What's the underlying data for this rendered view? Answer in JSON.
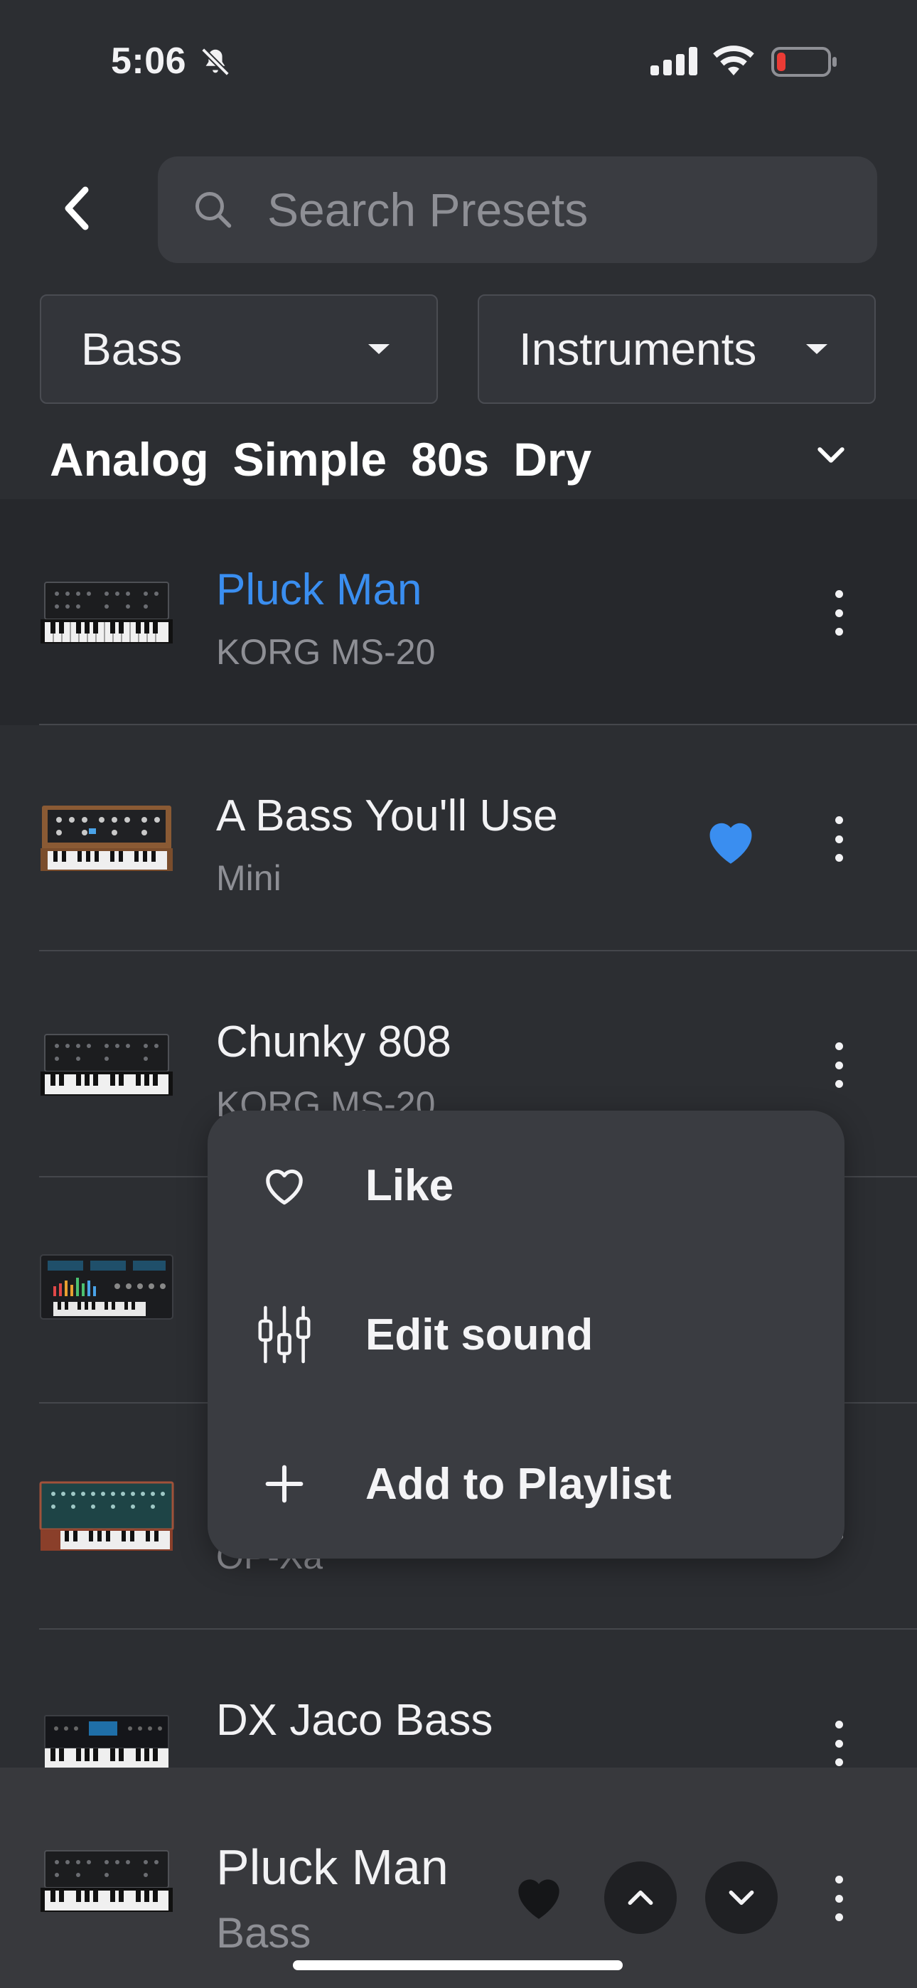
{
  "status_bar": {
    "time": "5:06"
  },
  "search": {
    "placeholder": "Search Presets"
  },
  "filters": {
    "category": "Bass",
    "source": "Instruments"
  },
  "tags": [
    "Analog",
    "Simple",
    "80s",
    "Dry"
  ],
  "presets": [
    {
      "title": "Pluck Man",
      "subtitle": "KORG MS-20",
      "selected": true,
      "liked": false,
      "thumb": "ms20"
    },
    {
      "title": "A Bass You'll Use",
      "subtitle": "Mini",
      "selected": false,
      "liked": true,
      "thumb": "mini"
    },
    {
      "title": "Chunky 808",
      "subtitle": "KORG MS-20",
      "selected": false,
      "liked": false,
      "thumb": "ms20"
    },
    {
      "title": "",
      "subtitle": "",
      "selected": false,
      "liked": false,
      "thumb": "wavestate"
    },
    {
      "title": "",
      "subtitle": "OP-Xa",
      "selected": false,
      "liked": false,
      "thumb": "opxa"
    },
    {
      "title": "DX Jaco Bass",
      "subtitle": "",
      "selected": false,
      "liked": false,
      "thumb": "dx"
    }
  ],
  "context_menu": {
    "items": [
      {
        "label": "Like",
        "icon": "heart-outline-icon"
      },
      {
        "label": "Edit sound",
        "icon": "sliders-icon"
      },
      {
        "label": "Add to Playlist",
        "icon": "plus-icon"
      }
    ]
  },
  "player": {
    "title": "Pluck Man",
    "subtitle": "Bass"
  },
  "colors": {
    "background": "#2c2e32",
    "accent": "#3a8ef0",
    "menu": "#3a3c41",
    "player": "#38393d"
  }
}
